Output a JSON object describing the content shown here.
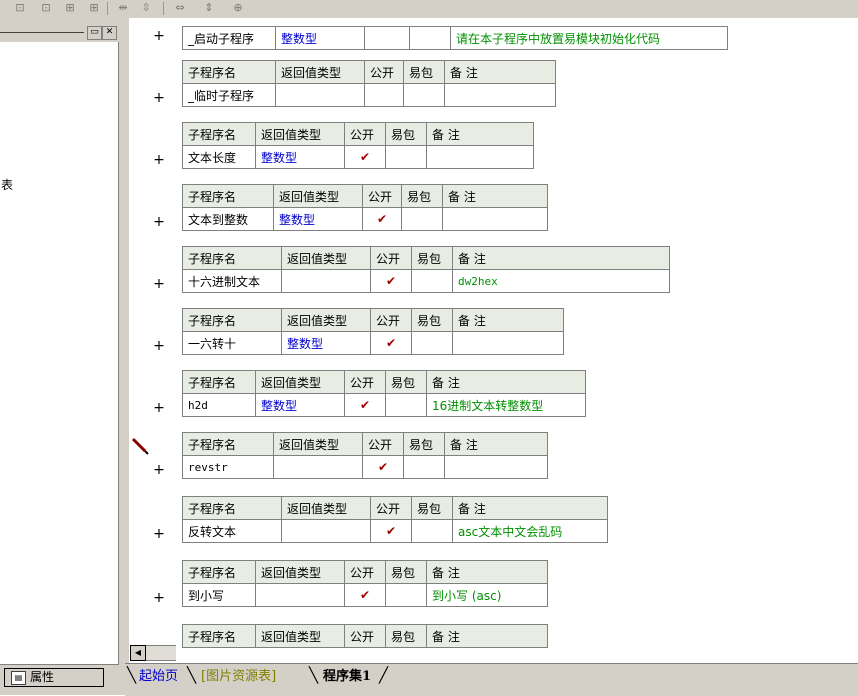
{
  "left_panel": {
    "fragment": "表",
    "properties_tab": "属性"
  },
  "bottom_tabs": [
    {
      "label": "起始页"
    },
    {
      "label": "[图片资源表]"
    },
    {
      "label": "程序集1"
    }
  ],
  "headers": {
    "name": "子程序名",
    "return_type": "返回值类型",
    "public": "公开",
    "easy_pack": "易包",
    "remark": "备 注"
  },
  "subroutines": [
    {
      "name": "_启动子程序",
      "return_type": "整数型",
      "public": "",
      "remark": "请在本子程序中放置易模块初始化代码"
    },
    {
      "name": "_临时子程序",
      "return_type": "",
      "public": "",
      "remark": ""
    },
    {
      "name": "文本长度",
      "return_type": "整数型",
      "public": "✔",
      "remark": ""
    },
    {
      "name": "文本到整数",
      "return_type": "整数型",
      "public": "✔",
      "remark": ""
    },
    {
      "name": "十六进制文本",
      "return_type": "",
      "public": "✔",
      "remark": "dw2hex"
    },
    {
      "name": "一六转十",
      "return_type": "整数型",
      "public": "✔",
      "remark": ""
    },
    {
      "name": "h2d",
      "return_type": "整数型",
      "public": "✔",
      "remark": "16进制文本转整数型"
    },
    {
      "name": "revstr",
      "return_type": "",
      "public": "✔",
      "remark": ""
    },
    {
      "name": "反转文本",
      "return_type": "",
      "public": "✔",
      "remark": "asc文本中文会乱码"
    },
    {
      "name": "到小写",
      "return_type": "",
      "public": "✔",
      "remark": "到小写 (asc)"
    }
  ],
  "icons": {
    "pencil": "pencil-icon",
    "properties": "properties-icon",
    "minimize": "minimize-icon",
    "close": "close-icon"
  }
}
